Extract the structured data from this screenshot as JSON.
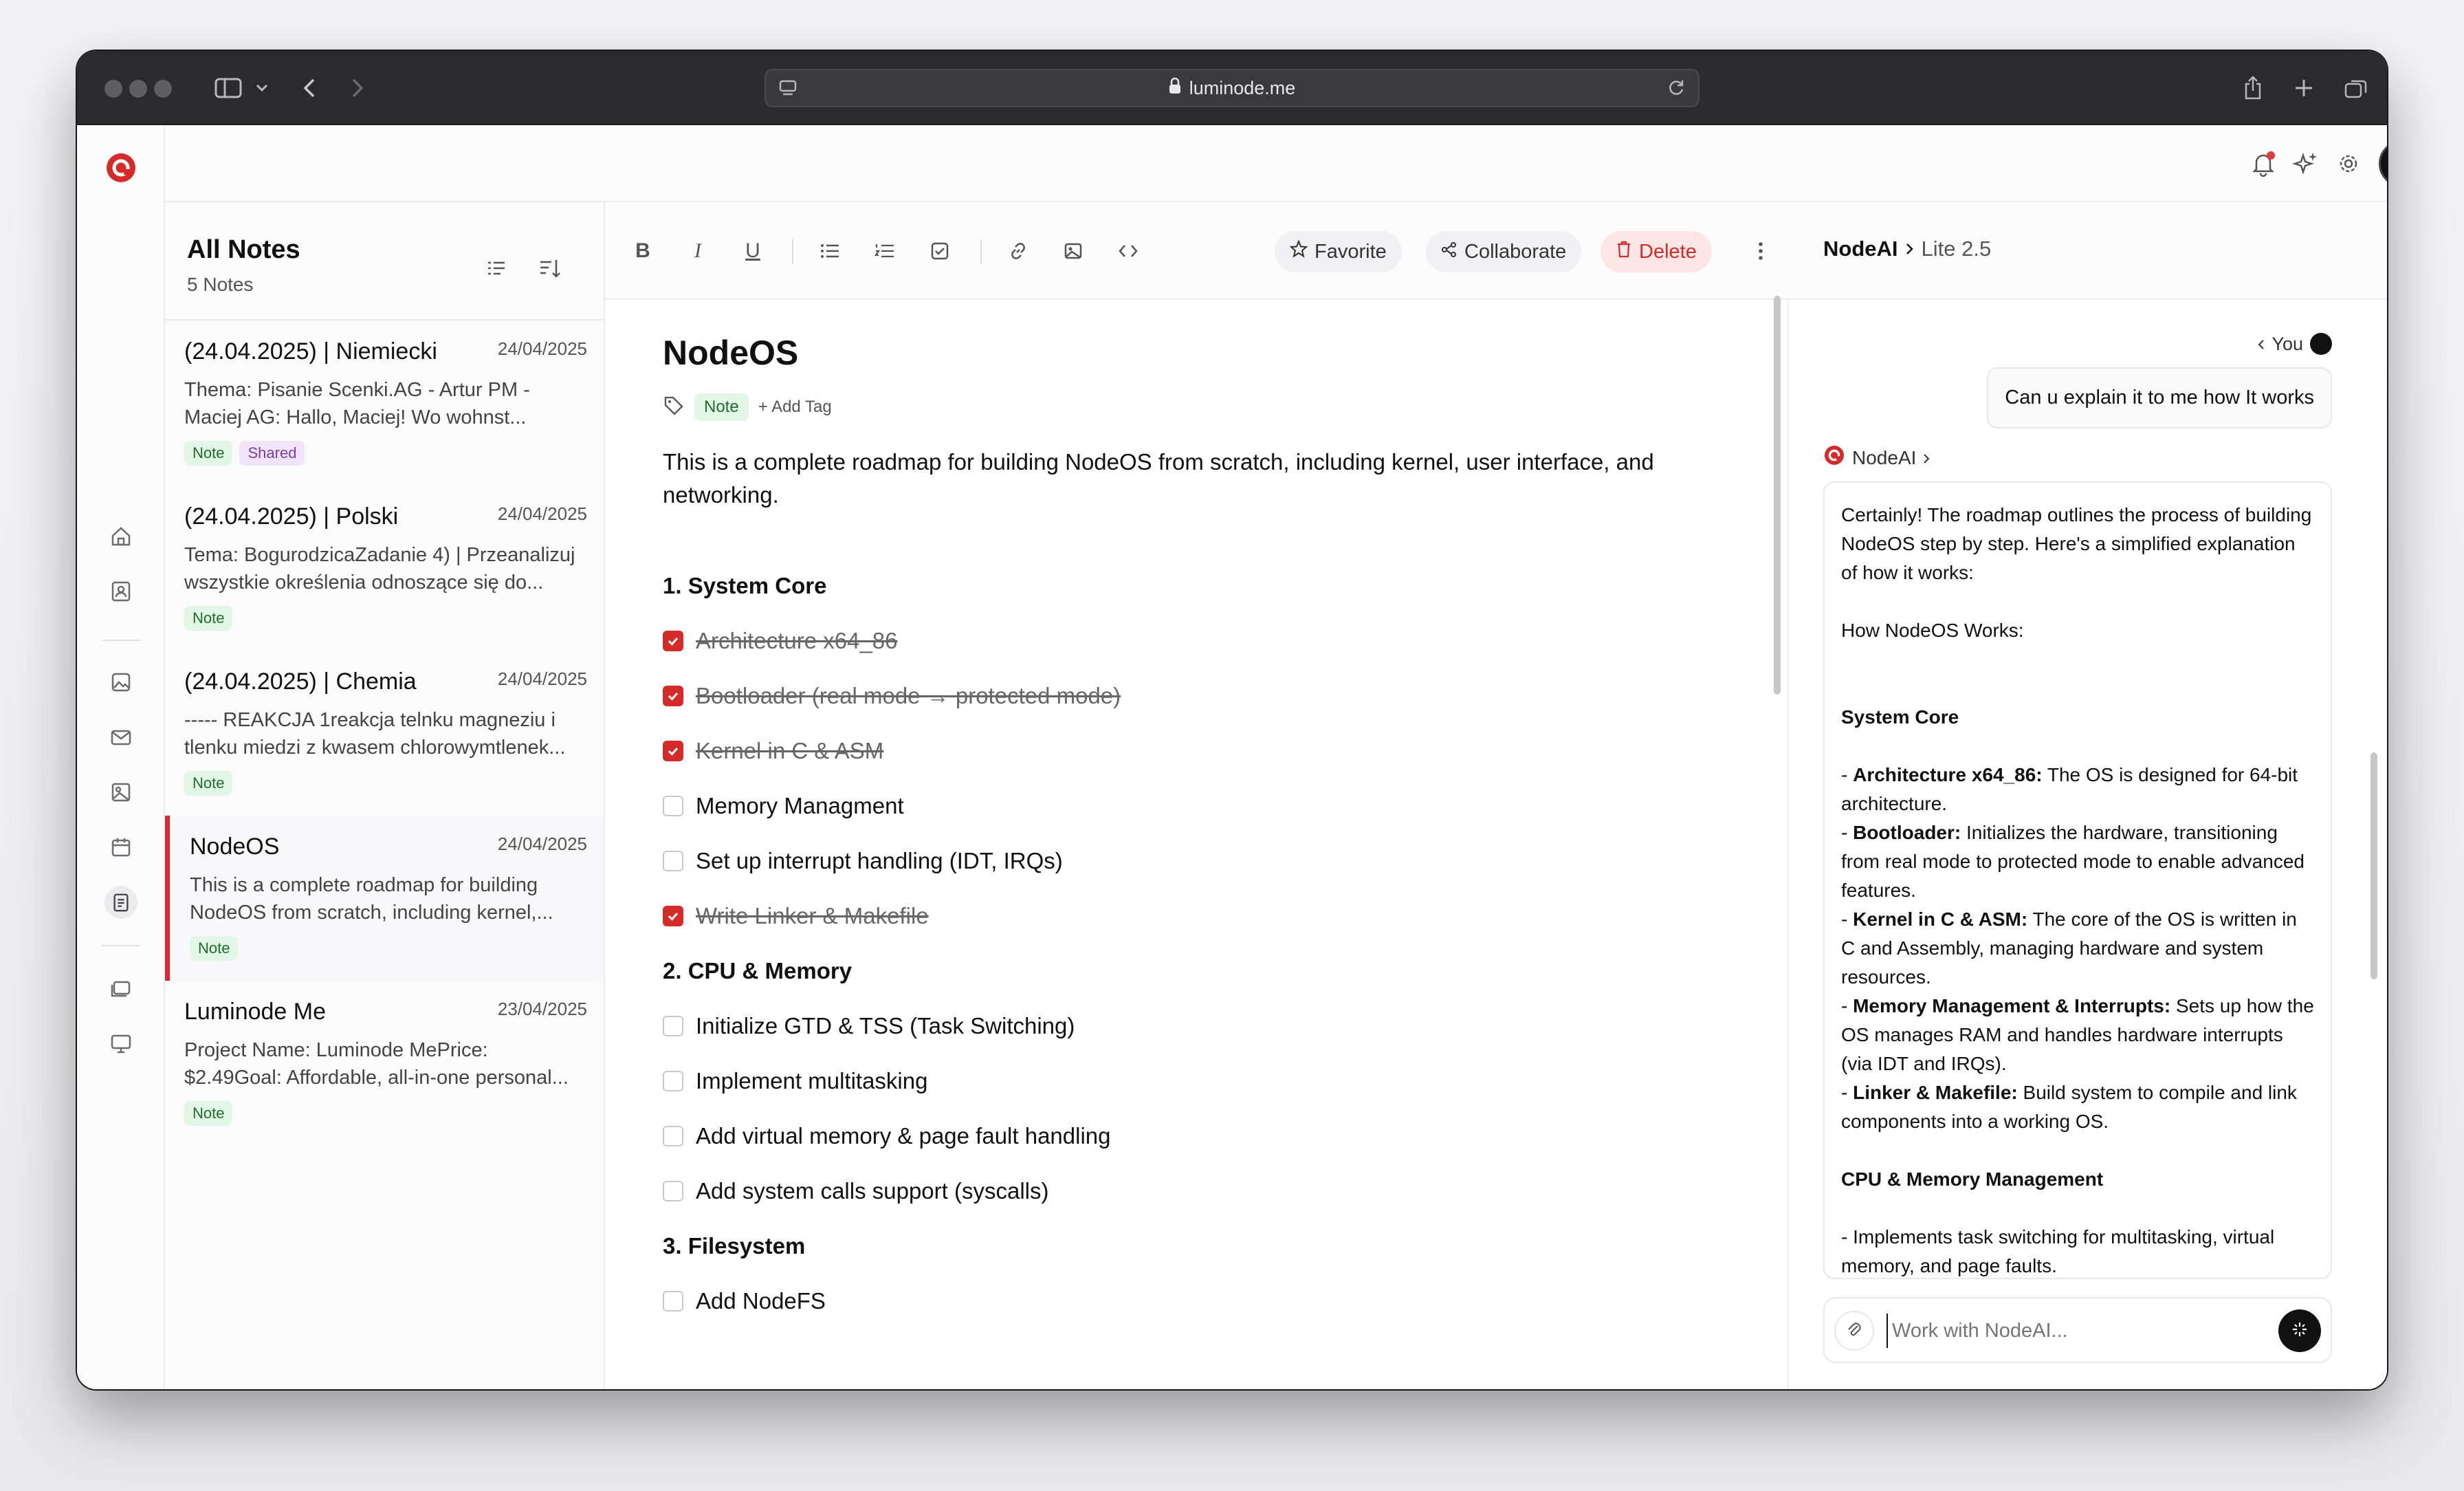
{
  "browser": {
    "url": "luminode.me"
  },
  "notes_list": {
    "title": "All Notes",
    "count": "5 Notes",
    "items": [
      {
        "title": "(24.04.2025) | Niemiecki",
        "date": "24/04/2025",
        "snippet": "Thema: Pisanie Scenki.AG - Artur PM - Maciej AG: Hallo, Maciej! Wo wohnst...",
        "tags": [
          "Note",
          "Shared"
        ]
      },
      {
        "title": "(24.04.2025) | Polski",
        "date": "24/04/2025",
        "snippet": "Tema: BogurodzicaZadanie 4) | Przeanalizuj wszystkie określenia odnoszące się do...",
        "tags": [
          "Note"
        ]
      },
      {
        "title": "(24.04.2025) | Chemia",
        "date": "24/04/2025",
        "snippet": "----- REAKCJA 1reakcja telnku magneziu i tlenku miedzi z kwasem chlorowymtlenek...",
        "tags": [
          "Note"
        ]
      },
      {
        "title": "NodeOS",
        "date": "24/04/2025",
        "snippet": "This is a complete roadmap for building NodeOS from scratch, including kernel,...",
        "tags": [
          "Note"
        ]
      },
      {
        "title": "Luminode Me",
        "date": "23/04/2025",
        "snippet": "Project Name: Luminode MePrice: $2.49Goal: Affordable, all-in-one personal...",
        "tags": [
          "Note"
        ]
      }
    ]
  },
  "toolbar": {
    "favorite": "Favorite",
    "collaborate": "Collaborate",
    "delete": "Delete"
  },
  "document": {
    "title": "NodeOS",
    "tag": "Note",
    "add_tag": "+ Add Tag",
    "intro": "This is a complete roadmap for building NodeOS from scratch, including kernel, user interface, and networking.",
    "sections": [
      {
        "heading": "1. System Core",
        "tasks": [
          {
            "text": "Architecture x64_86",
            "done": true
          },
          {
            "text": "Bootloader (real mode → protected mode)",
            "done": true
          },
          {
            "text": "Kernel in C & ASM",
            "done": true
          },
          {
            "text": "Memory Managment",
            "done": false
          },
          {
            "text": "Set up interrupt handling (IDT, IRQs)",
            "done": false
          },
          {
            "text": "Write Linker & Makefile",
            "done": true
          }
        ]
      },
      {
        "heading": "2. CPU & Memory",
        "tasks": [
          {
            "text": "Initialize GTD & TSS (Task Switching)",
            "done": false
          },
          {
            "text": "Implement multitasking",
            "done": false
          },
          {
            "text": "Add virtual memory & page fault handling",
            "done": false
          },
          {
            "text": "Add system calls support (syscalls)",
            "done": false
          }
        ]
      },
      {
        "heading": "3. Filesystem",
        "tasks": [
          {
            "text": "Add NodeFS",
            "done": false
          }
        ]
      }
    ]
  },
  "ai": {
    "name": "NodeAI",
    "model": "Lite 2.5",
    "you_label": "You",
    "user_message": "Can u explain it to me how It works",
    "ai_label": "NodeAI",
    "response": {
      "intro": "Certainly! The roadmap outlines the process of building NodeOS step by step. Here's a simplified explanation of how it works:",
      "subtitle": "How NodeOS Works:",
      "section1": "System Core",
      "items": [
        {
          "bold": "Architecture x64_86:",
          "text": " The OS is designed for 64-bit architecture."
        },
        {
          "bold": "Bootloader:",
          "text": " Initializes the hardware, transitioning from real mode to protected mode to enable advanced features."
        },
        {
          "bold": "Kernel in C & ASM:",
          "text": " The core of the OS is written in C and Assembly, managing hardware and system resources."
        },
        {
          "bold": "Memory Management & Interrupts:",
          "text": " Sets up how the OS manages RAM and handles hardware interrupts (via IDT and IRQs)."
        },
        {
          "bold": "Linker & Makefile:",
          "text": " Build system to compile and link components into a working OS."
        }
      ],
      "section2": "CPU & Memory Management",
      "section2_text": "- Implements task switching for multitasking, virtual memory, and page faults."
    },
    "input_placeholder": "Work with NodeAI..."
  },
  "colors": {
    "accent": "#d42a2a",
    "tag_note_bg": "#e3f7e6",
    "tag_shared_bg": "#f2e5fb"
  }
}
